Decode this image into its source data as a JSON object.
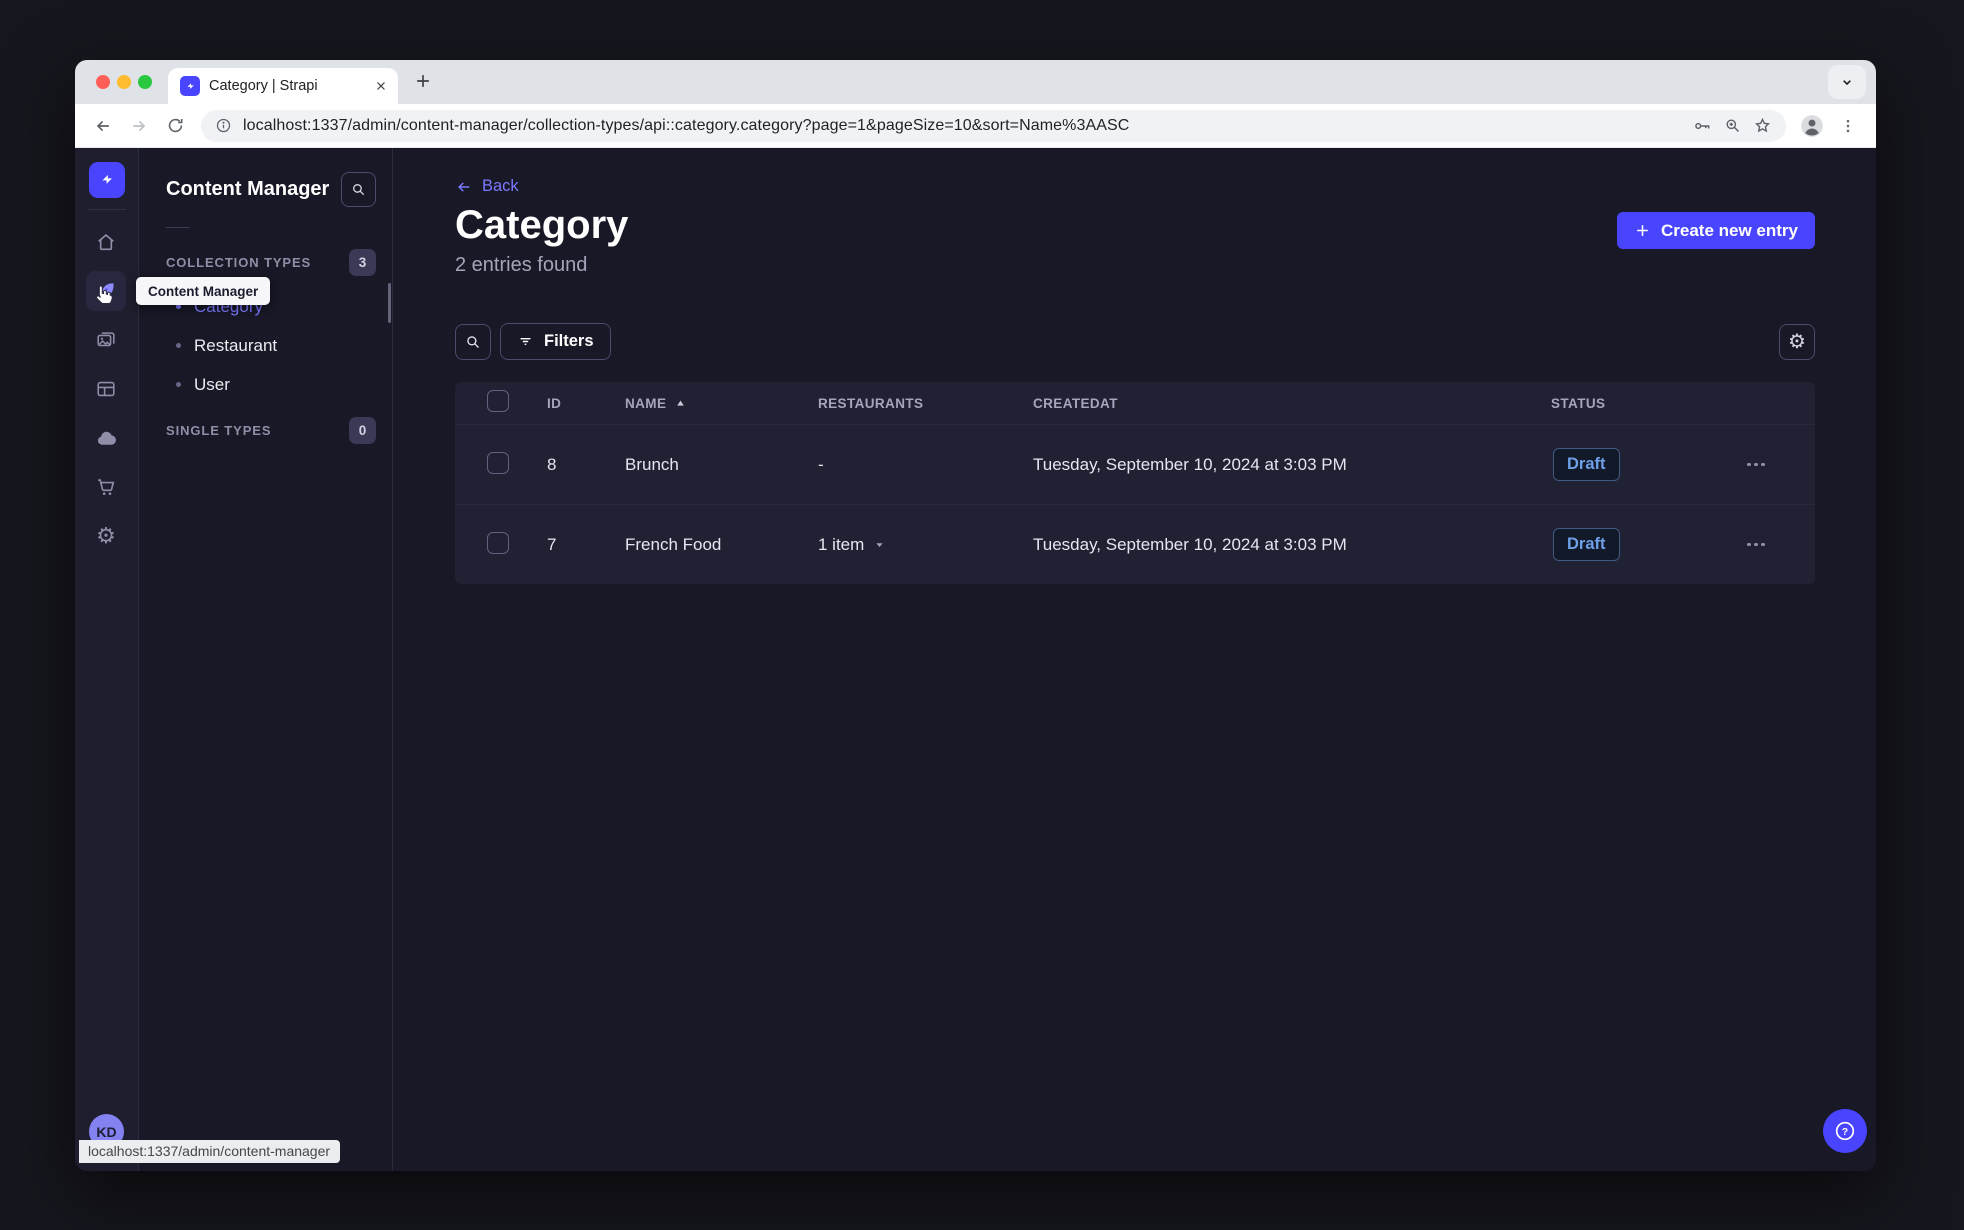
{
  "browser": {
    "tab_title": "Category | Strapi",
    "url": "localhost:1337/admin/content-manager/collection-types/api::category.category?page=1&pageSize=10&sort=Name%3AASC",
    "status_link": "localhost:1337/admin/content-manager"
  },
  "tooltip_label": "Content Manager",
  "sidebar": {
    "avatar_initials": "KD"
  },
  "subnav": {
    "title": "Content Manager",
    "collection_types": {
      "label": "COLLECTION TYPES",
      "count": "3"
    },
    "single_types": {
      "label": "SINGLE TYPES",
      "count": "0"
    },
    "items": [
      {
        "label": "Category"
      },
      {
        "label": "Restaurant"
      },
      {
        "label": "User"
      }
    ]
  },
  "main": {
    "back_label": "Back",
    "title": "Category",
    "subtitle": "2 entries found",
    "create_button": "Create new entry",
    "filters_button": "Filters"
  },
  "table": {
    "headers": {
      "id": "ID",
      "name": "NAME",
      "restaurants": "RESTAURANTS",
      "created": "CREATEDAT",
      "status": "STATUS"
    },
    "rows": [
      {
        "id": "8",
        "name": "Brunch",
        "restaurants": "-",
        "created": "Tuesday, September 10, 2024 at 3:03 PM",
        "status": "Draft"
      },
      {
        "id": "7",
        "name": "French Food",
        "restaurants": "1 item",
        "created": "Tuesday, September 10, 2024 at 3:03 PM",
        "status": "Draft"
      }
    ]
  },
  "icons": {
    "gear": "⚙"
  },
  "colors": {
    "primary": "#4945ff",
    "link": "#7b79ff",
    "draft_text": "#6f9fe8",
    "nav_bg": "#1e1e2e",
    "content_bg": "#181826",
    "table_bg": "#212134"
  }
}
